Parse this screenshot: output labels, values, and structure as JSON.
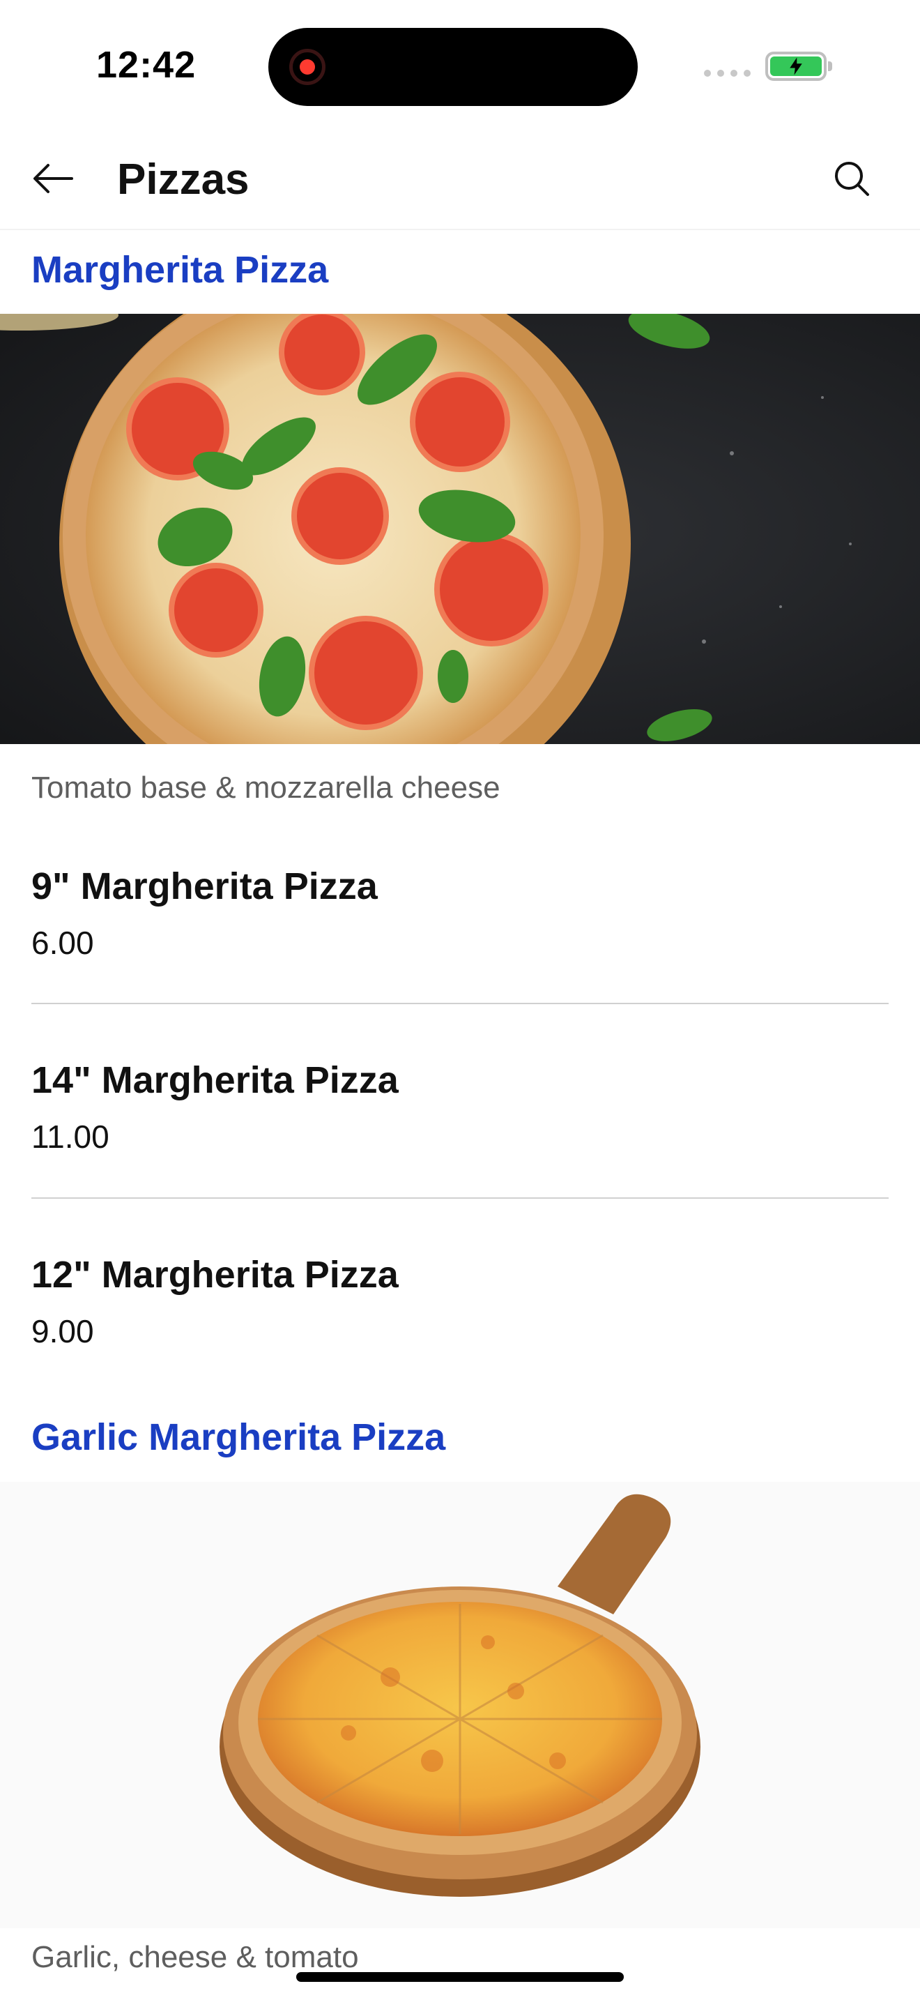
{
  "status_bar": {
    "time": "12:42"
  },
  "header": {
    "title": "Pizzas"
  },
  "sections": [
    {
      "title": "Margherita Pizza",
      "description": "Tomato base & mozzarella cheese",
      "items": [
        {
          "name": "9\" Margherita Pizza",
          "price": "6.00"
        },
        {
          "name": "14\" Margherita Pizza",
          "price": "11.00"
        },
        {
          "name": "12\" Margherita Pizza",
          "price": "9.00"
        }
      ]
    },
    {
      "title": "Garlic Margherita Pizza",
      "description": "Garlic, cheese & tomato"
    }
  ],
  "colors": {
    "section_title": "#1a3ec2",
    "battery": "#34c759"
  }
}
